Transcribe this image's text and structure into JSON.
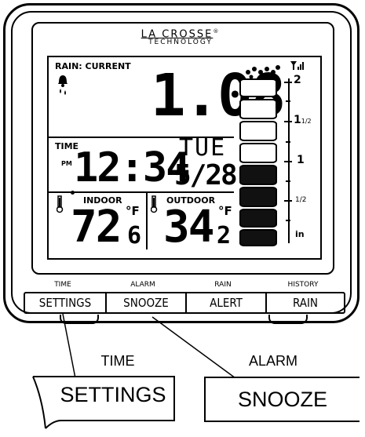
{
  "brand": {
    "line1": "LA CROSSE",
    "reg": "®",
    "line2": "TECHNOLOGY"
  },
  "lcd": {
    "rain_label": "RAIN: CURRENT",
    "rain_value": "1.08",
    "time_label": "TIME",
    "pm_label": "PM",
    "time_value": "12:34",
    "day": "TUE",
    "date": "5/28",
    "indoor_label": "INDOOR",
    "indoor_whole": "72",
    "indoor_dec": "6",
    "indoor_unit": "°F",
    "outdoor_label": "OUTDOOR",
    "outdoor_whole": "34",
    "outdoor_dec": "2",
    "outdoor_unit": "°F",
    "scale": {
      "s2": "2",
      "s1_5": "1",
      "s1_5_frac": "1/2",
      "s1": "1",
      "s0_5": "1/2",
      "unit": "in"
    },
    "gauge_fill_fraction": 0.5
  },
  "buttons": [
    {
      "top": "TIME",
      "label": "SETTINGS"
    },
    {
      "top": "ALARM",
      "label": "SNOOZE"
    },
    {
      "top": "RAIN",
      "label": "ALERT"
    },
    {
      "top": "HISTORY",
      "label": "RAIN"
    }
  ],
  "zoom": {
    "left_label": "TIME",
    "left_button": "SETTINGS",
    "right_label": "ALARM",
    "right_button": "SNOOZE"
  },
  "icons": [
    "bell-icon",
    "raindrop-icon",
    "signal-icon",
    "thermometer-icon",
    "rain-cloud-icon"
  ]
}
